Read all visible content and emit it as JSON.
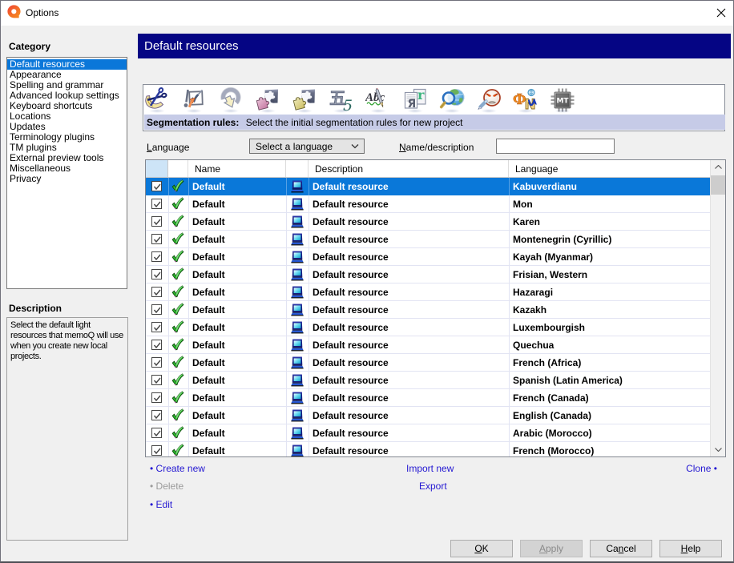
{
  "window": {
    "title": "Options"
  },
  "colors": {
    "band_navy": "#050584",
    "selection_blue": "#0a78d9",
    "strip_lavender": "#c6cbe7",
    "link_blue": "#2418d2",
    "link_disabled_gray": "#9b9b9b"
  },
  "sidebar": {
    "category_label": "Category",
    "categories": [
      "Default resources",
      "Appearance",
      "Spelling and grammar",
      "Advanced lookup settings",
      "Keyboard shortcuts",
      "Locations",
      "Updates",
      "Terminology plugins",
      "TM plugins",
      "External preview tools",
      "Miscellaneous",
      "Privacy"
    ],
    "selected_category": "Default resources",
    "description_label": "Description",
    "description_text": "Select the default light resources that memoQ will use when you create new local projects."
  },
  "header": {
    "title": "Default resources"
  },
  "toolbar": {
    "icons": [
      "segmentation-rules-icon",
      "qa-settings-icon",
      "auto-translation-icon",
      "puzzle-pink-icon",
      "puzzle-yellow-icon",
      "number-formats-icon",
      "ignore-lists-icon",
      "transliteration-icon",
      "web-search-icon",
      "forbidden-terms-icon",
      "font-substitution-icon",
      "mt-settings-icon"
    ],
    "strip_bold": "Segmentation rules:",
    "strip_text": "Select the initial segmentation rules for new project"
  },
  "filters": {
    "language_label": {
      "text": "Language",
      "accel": 0
    },
    "language_value": "Select a language",
    "name_label": {
      "text": "Name/description",
      "accel": 0
    },
    "name_value": ""
  },
  "table": {
    "columns": {
      "name": "Name",
      "description": "Description",
      "language": "Language"
    },
    "rows": [
      {
        "checked": true,
        "name": "Default",
        "description": "Default resource",
        "language": "Kabuverdianu",
        "selected": true
      },
      {
        "checked": true,
        "name": "Default",
        "description": "Default resource",
        "language": "Mon",
        "selected": false
      },
      {
        "checked": true,
        "name": "Default",
        "description": "Default resource",
        "language": "Karen",
        "selected": false
      },
      {
        "checked": true,
        "name": "Default",
        "description": "Default resource",
        "language": "Montenegrin (Cyrillic)",
        "selected": false
      },
      {
        "checked": true,
        "name": "Default",
        "description": "Default resource",
        "language": "Kayah (Myanmar)",
        "selected": false
      },
      {
        "checked": true,
        "name": "Default",
        "description": "Default resource",
        "language": "Frisian, Western",
        "selected": false
      },
      {
        "checked": true,
        "name": "Default",
        "description": "Default resource",
        "language": "Hazaragi",
        "selected": false
      },
      {
        "checked": true,
        "name": "Default",
        "description": "Default resource",
        "language": "Kazakh",
        "selected": false
      },
      {
        "checked": true,
        "name": "Default",
        "description": "Default resource",
        "language": "Luxembourgish",
        "selected": false
      },
      {
        "checked": true,
        "name": "Default",
        "description": "Default resource",
        "language": "Quechua",
        "selected": false
      },
      {
        "checked": true,
        "name": "Default",
        "description": "Default resource",
        "language": "French (Africa)",
        "selected": false
      },
      {
        "checked": true,
        "name": "Default",
        "description": "Default resource",
        "language": "Spanish (Latin America)",
        "selected": false
      },
      {
        "checked": true,
        "name": "Default",
        "description": "Default resource",
        "language": "French (Canada)",
        "selected": false
      },
      {
        "checked": true,
        "name": "Default",
        "description": "Default resource",
        "language": "English (Canada)",
        "selected": false
      },
      {
        "checked": true,
        "name": "Default",
        "description": "Default resource",
        "language": "Arabic (Morocco)",
        "selected": false
      },
      {
        "checked": true,
        "name": "Default",
        "description": "Default resource",
        "language": "French (Morocco)",
        "selected": false
      }
    ]
  },
  "links": {
    "create_new": "Create new",
    "delete": "Delete",
    "edit": "Edit",
    "import_new": "Import new",
    "export": "Export",
    "clone": "Clone",
    "bullet": "•"
  },
  "buttons": {
    "ok": {
      "text": "OK",
      "accel": 0
    },
    "apply": {
      "text": "Apply",
      "accel": 0
    },
    "cancel": {
      "text": "Cancel",
      "accel": 2
    },
    "help": {
      "text": "Help",
      "accel": 0
    }
  }
}
